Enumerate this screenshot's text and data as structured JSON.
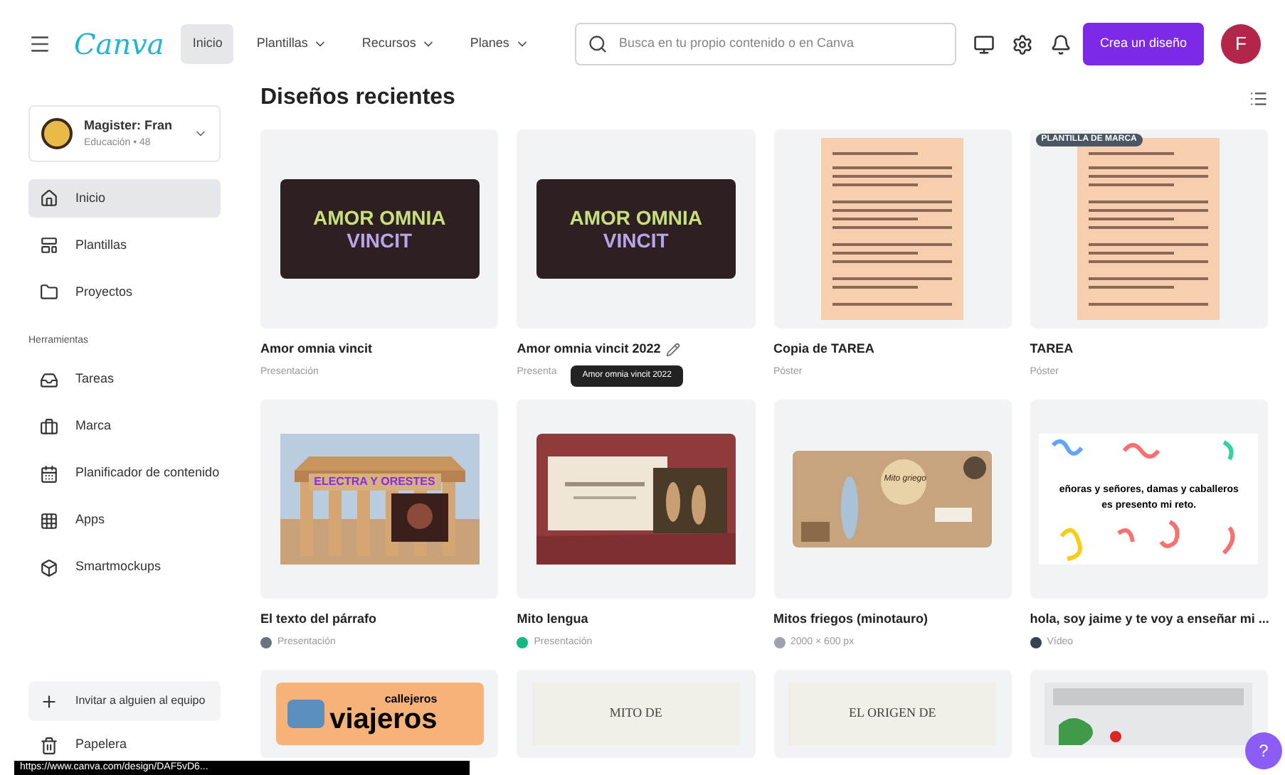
{
  "header": {
    "logo": "Canva",
    "nav": [
      {
        "label": "Inicio",
        "selected": true,
        "dropdown": false
      },
      {
        "label": "Plantillas",
        "selected": false,
        "dropdown": true
      },
      {
        "label": "Recursos",
        "selected": false,
        "dropdown": true
      },
      {
        "label": "Planes",
        "selected": false,
        "dropdown": true
      }
    ],
    "search": {
      "placeholder": "Busca en tu propio contenido o en Canva"
    },
    "create_button": "Crea un diseño",
    "avatar": "F"
  },
  "sidebar": {
    "account": {
      "name": "Magister: Fran",
      "subtitle": "Educación • 48"
    },
    "items": [
      {
        "label": "Inicio",
        "selected": true
      },
      {
        "label": "Plantillas",
        "selected": false
      },
      {
        "label": "Proyectos",
        "selected": false
      }
    ],
    "section": "Herramientas",
    "tools": [
      {
        "label": "Tareas",
        "selected": false
      },
      {
        "label": "Marca",
        "selected": false
      },
      {
        "label": "Planificador de contenido",
        "selected": false
      },
      {
        "label": "Apps",
        "selected": false
      },
      {
        "label": "Smartmockups",
        "selected": false
      }
    ],
    "invite": "Invitar a alguien al equipo",
    "trash": "Papelera"
  },
  "main": {
    "title": "Diseños recientes",
    "designs": [
      {
        "kind": "slide",
        "title": "Amor omnia vincit",
        "subtitle": "Presentación",
        "lines": [
          "AMOR OMNIA",
          "VINCIT"
        ]
      },
      {
        "kind": "slide",
        "title": "Amor omnia vincit 2022",
        "subtitle": "Presenta",
        "editing": true,
        "tooltip": "Amor omnia vincit 2022",
        "lines": [
          "AMOR OMNIA",
          "VINCIT"
        ]
      },
      {
        "kind": "document",
        "title": "Copia de TAREA",
        "subtitle": "Póster"
      },
      {
        "kind": "document",
        "title": "TAREA",
        "subtitle": "Póster",
        "badge": "PLANTILLA DE MARCA"
      },
      {
        "kind": "temple",
        "title": "El texto del párrafo",
        "subtitle": "Presentación",
        "color": "#6b7280",
        "lines": [
          "ELECTRA Y ORESTES"
        ]
      },
      {
        "kind": "paper",
        "title": "Mito lengua",
        "subtitle": "Presentación",
        "color": "#10b981"
      },
      {
        "kind": "collage",
        "title": "Mitos friegos (minotauro)",
        "subtitle": "2000 × 600 px",
        "color": "#9ca3af",
        "lines": [
          "Mito griego"
        ]
      },
      {
        "kind": "confetti",
        "title": "hola, soy jaime y te voy a enseñar mi ...",
        "subtitle": "Vídeo",
        "color": "#374151",
        "lines": [
          "eñoras y señores, damas y caballeros",
          "es presento mi reto."
        ]
      },
      {
        "kind": "travel",
        "lines": [
          "callejeros",
          "viajeros"
        ]
      },
      {
        "kind": "wreath",
        "lines": [
          "MITO DE"
        ]
      },
      {
        "kind": "lyre",
        "lines": [
          "EL ORIGEN DE"
        ]
      },
      {
        "kind": "map"
      }
    ]
  },
  "status_url": "https://www.canva.com/design/DAF5vD6...",
  "help": "?"
}
